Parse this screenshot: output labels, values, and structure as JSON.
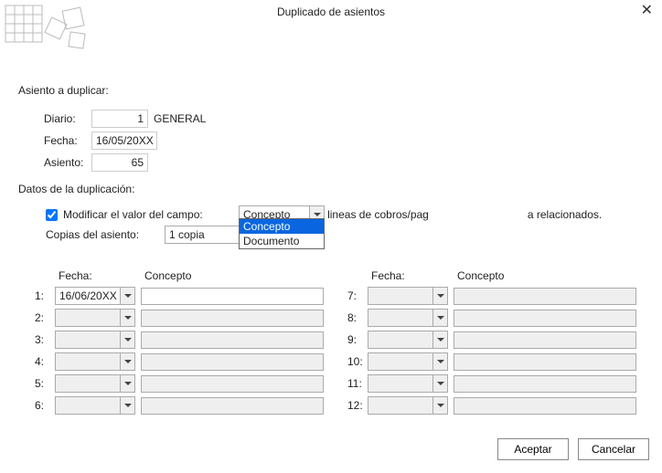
{
  "title": "Duplicado de asientos",
  "section_source": "Asiento a duplicar:",
  "labels": {
    "diario": "Diario:",
    "fecha": "Fecha:",
    "asiento": "Asiento:"
  },
  "source": {
    "diario_num": "1",
    "diario_name": "GENERAL",
    "fecha": "16/05/20XX",
    "asiento": "65"
  },
  "section_dup": "Datos de la duplicación:",
  "mod_field_label": "Modificar el valor del campo:",
  "mod_field_checked": true,
  "mod_field_options": [
    "Concepto",
    "Documento"
  ],
  "mod_field_selected": "Concepto",
  "dup_lines_label": "Duplicar las lineas de cobros/pagos de las descripciones a relacionados.",
  "dup_lines_label_visible_left": "Duplicar las lineas de cobros/pag",
  "dup_lines_label_visible_right": "a relacionados.",
  "dup_lines_checked": false,
  "copies_label": "Copias del asiento:",
  "copies_value": "1 copia",
  "grid_headers": {
    "fecha": "Fecha:",
    "concepto": "Concepto"
  },
  "rows_left": [
    {
      "n": "1:",
      "date": "16/06/20XX",
      "enabled": true,
      "concept": ""
    },
    {
      "n": "2:",
      "date": "",
      "enabled": false,
      "concept": ""
    },
    {
      "n": "3:",
      "date": "",
      "enabled": false,
      "concept": ""
    },
    {
      "n": "4:",
      "date": "",
      "enabled": false,
      "concept": ""
    },
    {
      "n": "5:",
      "date": "",
      "enabled": false,
      "concept": ""
    },
    {
      "n": "6:",
      "date": "",
      "enabled": false,
      "concept": ""
    }
  ],
  "rows_right": [
    {
      "n": "7:",
      "date": "",
      "enabled": false,
      "concept": ""
    },
    {
      "n": "8:",
      "date": "",
      "enabled": false,
      "concept": ""
    },
    {
      "n": "9:",
      "date": "",
      "enabled": false,
      "concept": ""
    },
    {
      "n": "10:",
      "date": "",
      "enabled": false,
      "concept": ""
    },
    {
      "n": "11:",
      "date": "",
      "enabled": false,
      "concept": ""
    },
    {
      "n": "12:",
      "date": "",
      "enabled": false,
      "concept": ""
    }
  ],
  "buttons": {
    "ok": "Aceptar",
    "cancel": "Cancelar"
  }
}
